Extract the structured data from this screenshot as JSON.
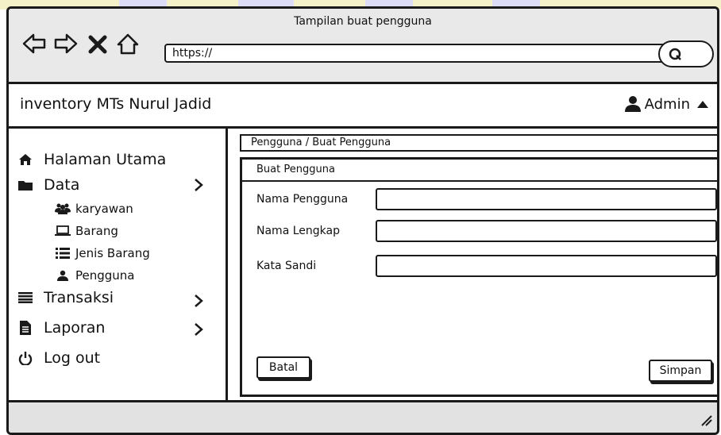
{
  "browser": {
    "title": "Tampilan buat pengguna",
    "url": "https://"
  },
  "app": {
    "brand": "inventory MTs Nurul Jadid",
    "user": "Admin"
  },
  "sidebar": {
    "items": [
      {
        "label": "Halaman Utama",
        "icon": "home-icon"
      },
      {
        "label": "Data",
        "icon": "folder-icon",
        "chevron": true
      },
      {
        "label": "karyawan",
        "icon": "users-icon",
        "sub": true
      },
      {
        "label": "Barang",
        "icon": "laptop-icon",
        "sub": true
      },
      {
        "label": "Jenis Barang",
        "icon": "list-icon",
        "sub": true
      },
      {
        "label": "Pengguna",
        "icon": "user-icon",
        "sub": true
      },
      {
        "label": "Transaksi",
        "icon": "bars-icon",
        "chevron": true
      },
      {
        "label": "Laporan",
        "icon": "document-icon",
        "chevron": true
      },
      {
        "label": "Log out",
        "icon": "power-icon"
      }
    ]
  },
  "breadcrumb": "Pengguna / Buat Pengguna",
  "form": {
    "title": "Buat Pengguna",
    "fields": [
      {
        "label": "Nama Pengguna",
        "value": ""
      },
      {
        "label": "Nama Lengkap",
        "value": ""
      },
      {
        "label": "Kata Sandi",
        "value": ""
      }
    ],
    "cancel_label": "Batal",
    "save_label": "Simpan"
  }
}
